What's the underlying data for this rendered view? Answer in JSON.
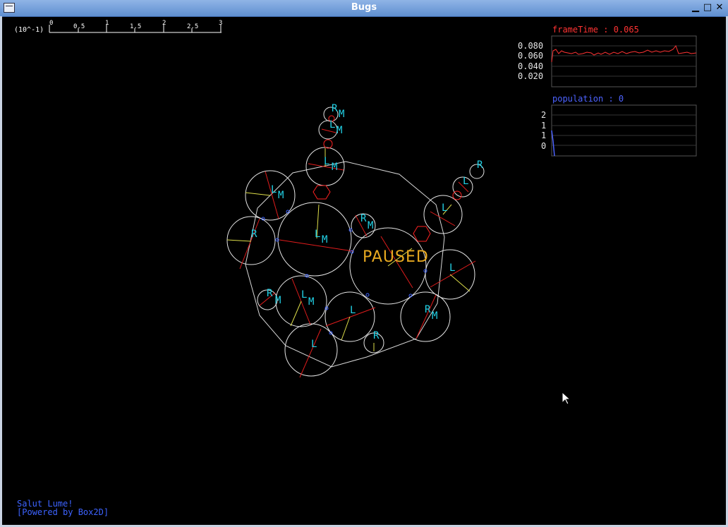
{
  "window": {
    "title": "Bugs"
  },
  "ruler": {
    "unit_label": "(10^-1)",
    "ticks": [
      "0",
      "0.5",
      "1",
      "1.5",
      "2",
      "2.5",
      "3"
    ]
  },
  "status": {
    "paused_text": "PAUSED"
  },
  "graphs": {
    "frametime": {
      "label": "frameTime : 0.065",
      "color": "#ff3333",
      "yticks": [
        "0.080",
        "0.060",
        "0.040",
        "0.020"
      ]
    },
    "population": {
      "label": "population : 0",
      "color": "#4d63ff",
      "yticks": [
        "2",
        "1",
        "1",
        "0"
      ]
    }
  },
  "footer": {
    "line1": "Salut Lume!",
    "line2": "[Powered by Box2D]"
  },
  "colors": {
    "body_outline": "#e6e6e6",
    "node_label": "#22d3e8",
    "joint": "#ff2222",
    "sensor": "#e6e64c"
  }
}
